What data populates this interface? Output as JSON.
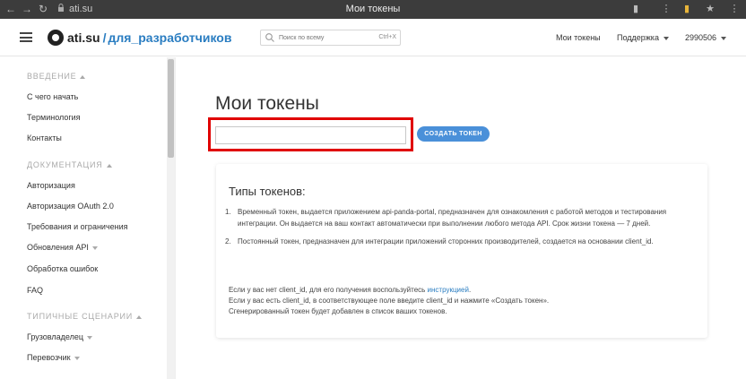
{
  "browser": {
    "url": "ati.su",
    "tab_title": "Мои токены"
  },
  "header": {
    "logo_main": "ati.su",
    "logo_sep": "/",
    "logo_sub": "для_разработчиков",
    "search_placeholder": "Поиск по всему",
    "search_hint": "Ctrl+X",
    "nav_tokens": "Мои токены",
    "nav_support": "Поддержка",
    "nav_user": "2990506"
  },
  "sidebar": {
    "sections": [
      {
        "title": "ВВЕДЕНИЕ",
        "items": [
          "С чего начать",
          "Терминология",
          "Контакты"
        ]
      },
      {
        "title": "ДОКУМЕНТАЦИЯ",
        "items": [
          "Авторизация",
          "Авторизация OAuth 2.0",
          "Требования и ограничения",
          "Обновления API",
          "Обработка ошибок",
          "FAQ"
        ]
      },
      {
        "title": "ТИПИЧНЫЕ СЦЕНАРИИ",
        "items": [
          "Грузовладелец",
          "Перевозчик"
        ]
      }
    ]
  },
  "main": {
    "title": "Мои токены",
    "token_input_value": "",
    "create_button": "СОЗДАТЬ ТОКЕН",
    "card": {
      "title": "Типы токенов:",
      "list": [
        {
          "num": "1.",
          "text": "Временный токен, выдается приложением api-panda-portal, предназначен для ознакомления с работой методов и тестирования интеграции. Он выдается на ваш контакт автоматически при выполнении любого метода API. Срок жизни токена — 7 дней."
        },
        {
          "num": "2.",
          "text": "Постоянный токен, предназначен для интеграции приложений сторонних производителей, создается на основании client_id."
        }
      ],
      "note_line1_before": "Если у вас нет client_id, для его получения воспользуйтесь ",
      "note_line1_link": "инструкцией",
      "note_line1_after": ".",
      "note_line2": "Если у вас есть client_id, в соответствующее поле введите client_id и нажмите «Создать токен».",
      "note_line3": "Сгенерированный токен будет добавлен в список ваших токенов."
    }
  },
  "colors": {
    "accent": "#2a7dc1",
    "button": "#4a90d9",
    "highlight": "#e00000"
  }
}
